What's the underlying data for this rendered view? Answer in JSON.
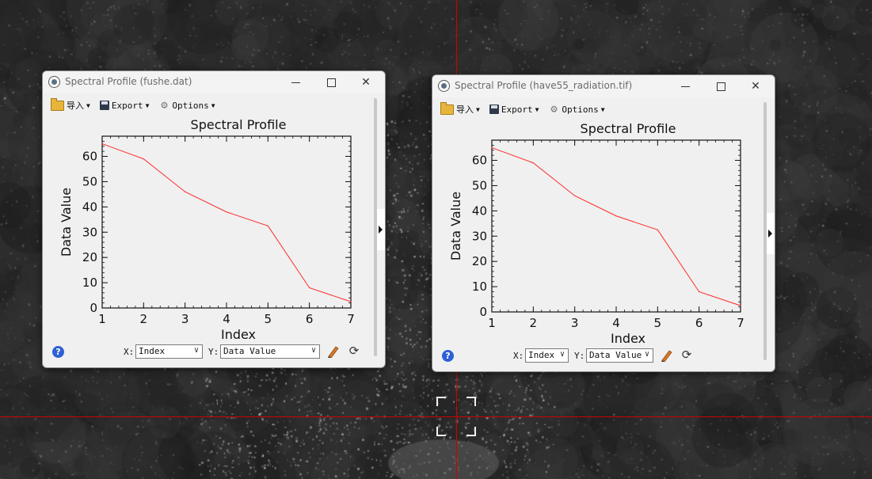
{
  "windows": [
    {
      "title": "Spectral Profile (fushe.dat)",
      "toolbar": {
        "import_label": "导入",
        "export_label": "Export",
        "options_label": "Options"
      },
      "controls": {
        "x_label": "X:",
        "x_value": "Index",
        "y_label": "Y:",
        "y_value": "Data Value"
      }
    },
    {
      "title": "Spectral Profile (have55_radiation.tif)",
      "toolbar": {
        "import_label": "导入",
        "export_label": "Export",
        "options_label": "Options"
      },
      "controls": {
        "x_label": "X:",
        "x_value": "Index",
        "y_label": "Y:",
        "y_value": "Data Value"
      }
    }
  ],
  "icons": [
    "app-icon",
    "folder-icon",
    "save-icon",
    "gear-icon",
    "help-icon",
    "pencil-icon",
    "refresh-icon",
    "minimize-icon",
    "maximize-icon",
    "close-icon"
  ],
  "colors": {
    "series": "#ff2a2a",
    "crosshair": "#d10000",
    "help": "#2f5fd6"
  },
  "chart_data": [
    {
      "type": "line",
      "title": "Spectral Profile",
      "xlabel": "Index",
      "ylabel": "Data Value",
      "x": [
        1,
        2,
        3,
        4,
        5,
        6,
        7
      ],
      "series": [
        {
          "values": [
            65,
            59,
            46,
            38,
            32.5,
            8,
            2.5
          ]
        }
      ],
      "xlim": [
        1,
        7
      ],
      "ylim": [
        0,
        68
      ],
      "xticks": [
        1,
        2,
        3,
        4,
        5,
        6,
        7
      ],
      "yticks": [
        0,
        10,
        20,
        30,
        40,
        50,
        60
      ],
      "grid": false
    },
    {
      "type": "line",
      "title": "Spectral Profile",
      "xlabel": "Index",
      "ylabel": "Data Value",
      "x": [
        1,
        2,
        3,
        4,
        5,
        6,
        7
      ],
      "series": [
        {
          "values": [
            65,
            59,
            46,
            38,
            32.5,
            8,
            2.5
          ]
        }
      ],
      "xlim": [
        1,
        7
      ],
      "ylim": [
        0,
        68
      ],
      "xticks": [
        1,
        2,
        3,
        4,
        5,
        6,
        7
      ],
      "yticks": [
        0,
        10,
        20,
        30,
        40,
        50,
        60
      ],
      "grid": false
    }
  ]
}
